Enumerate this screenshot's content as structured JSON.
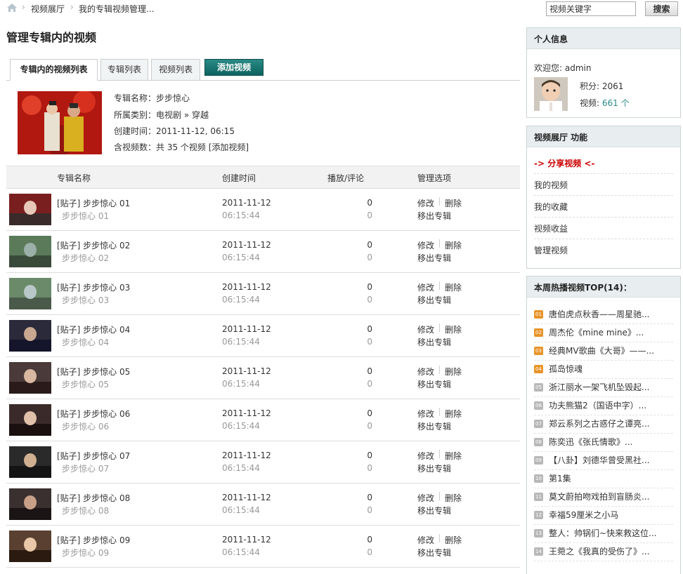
{
  "breadcrumb": [
    "视频展厅",
    "我的专辑视频管理..."
  ],
  "search": {
    "value": "视频关键字",
    "button": "搜索"
  },
  "page_title": "管理专辑内的视频",
  "tabs": [
    {
      "label": "专辑内的视频列表",
      "active": true
    },
    {
      "label": "专辑列表",
      "active": false
    },
    {
      "label": "视频列表",
      "active": false
    },
    {
      "label": "添加视频",
      "active": false
    }
  ],
  "album": {
    "name": "专辑名称：步步惊心",
    "category": "所属类别：电视剧 » 穿越",
    "created": "创建时间：2011-11-12, 06:15",
    "count": "含视频数：共 35 个视频",
    "add_link": "[添加视频]"
  },
  "columns": [
    "专辑名称",
    "创建时间",
    "播放/评论",
    "管理选项"
  ],
  "rows": [
    {
      "title": "[贴子] 步步惊心 01",
      "sub": "步步惊心 01",
      "date": "2011-11-12",
      "time": "06:15:44",
      "plays": "0",
      "comments": "0"
    },
    {
      "title": "[贴子] 步步惊心 02",
      "sub": "步步惊心 02",
      "date": "2011-11-12",
      "time": "06:15:44",
      "plays": "0",
      "comments": "0"
    },
    {
      "title": "[贴子] 步步惊心 03",
      "sub": "步步惊心 03",
      "date": "2011-11-12",
      "time": "06:15:44",
      "plays": "0",
      "comments": "0"
    },
    {
      "title": "[贴子] 步步惊心 04",
      "sub": "步步惊心 04",
      "date": "2011-11-12",
      "time": "06:15:44",
      "plays": "0",
      "comments": "0"
    },
    {
      "title": "[贴子] 步步惊心 05",
      "sub": "步步惊心 05",
      "date": "2011-11-12",
      "time": "06:15:44",
      "plays": "0",
      "comments": "0"
    },
    {
      "title": "[贴子] 步步惊心 06",
      "sub": "步步惊心 06",
      "date": "2011-11-12",
      "time": "06:15:44",
      "plays": "0",
      "comments": "0"
    },
    {
      "title": "[贴子] 步步惊心 07",
      "sub": "步步惊心 07",
      "date": "2011-11-12",
      "time": "06:15:44",
      "plays": "0",
      "comments": "0"
    },
    {
      "title": "[贴子] 步步惊心 08",
      "sub": "步步惊心 08",
      "date": "2011-11-12",
      "time": "06:15:44",
      "plays": "0",
      "comments": "0"
    },
    {
      "title": "[贴子] 步步惊心 09",
      "sub": "步步惊心 09",
      "date": "2011-11-12",
      "time": "06:15:44",
      "plays": "0",
      "comments": "0"
    }
  ],
  "row_actions": {
    "edit": "修改",
    "delete": "删除",
    "remove": "移出专辑"
  },
  "profile": {
    "heading": "个人信息",
    "welcome": "欢迎您: admin",
    "points_label": "积分: 2061",
    "videos_label": "视频:",
    "videos_value": "661 个"
  },
  "functions": {
    "heading": "视频展厅 功能",
    "share": "-> 分享视频 <-",
    "links": [
      "我的视频",
      "我的收藏",
      "视频收益",
      "管理视频"
    ]
  },
  "hot": {
    "heading": "本周热播视频TOP(14)：",
    "items": [
      {
        "num": "01",
        "title": "唐伯虎点秋香——周星驰...",
        "top": true
      },
      {
        "num": "02",
        "title": "周杰伦《mine mine》...",
        "top": true
      },
      {
        "num": "03",
        "title": "经典MV歌曲《大哥》——...",
        "top": true
      },
      {
        "num": "04",
        "title": "孤岛惊魂",
        "top": true
      },
      {
        "num": "05",
        "title": "浙江丽水一架飞机坠毁起...",
        "top": false
      },
      {
        "num": "06",
        "title": "功夫熊猫2（国语中字）...",
        "top": false
      },
      {
        "num": "07",
        "title": "郑云系列之古惑仔之谭亮...",
        "top": false
      },
      {
        "num": "08",
        "title": "陈奕迅《张氏情歌》...",
        "top": false
      },
      {
        "num": "09",
        "title": "【八卦】刘德华曾受黑社...",
        "top": false
      },
      {
        "num": "10",
        "title": "第1集",
        "top": false
      },
      {
        "num": "11",
        "title": "莫文蔚拍吻戏拍到盲肠炎...",
        "top": false
      },
      {
        "num": "12",
        "title": "幸福59厘米之小马",
        "top": false
      },
      {
        "num": "13",
        "title": "整人：帅锅们~快来救这位...",
        "top": false
      },
      {
        "num": "14",
        "title": "王菀之《我真的受伤了》...",
        "top": false
      }
    ]
  },
  "colors": {
    "accent_red": "#cc0000",
    "teal": "#1a7a76",
    "link_teal": "#2a8a86",
    "top_badge": "#e8942a",
    "badge_gray": "#b8b8b8"
  }
}
